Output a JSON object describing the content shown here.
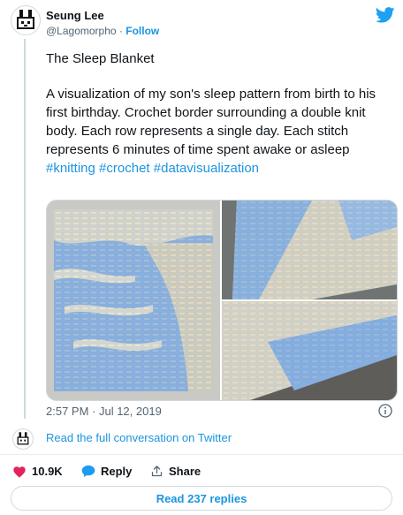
{
  "author": {
    "name": "Seung Lee",
    "handle": "@Lagomorpho",
    "separator": "·",
    "follow_label": "Follow"
  },
  "tweet": {
    "title": "The Sleep Blanket",
    "body": "A visualization of my son's sleep pattern from birth to his first birthday. Crochet border surrounding a double knit body. Each row represents a single day. Each stitch represents 6 minutes of time spent awake or asleep",
    "hashtags": [
      "#knitting",
      "#crochet",
      "#datavisualization"
    ],
    "timestamp": "2:57 PM · Jul 12, 2019"
  },
  "conversation_link": "Read the full conversation on Twitter",
  "actions": {
    "likes": "10.9K",
    "reply_label": "Reply",
    "share_label": "Share"
  },
  "read_replies": "Read 237 replies",
  "colors": {
    "link_blue": "#1b95e0",
    "heart_red": "#e0245e",
    "twitter_blue": "#1da1f2",
    "muted_text": "#536471"
  },
  "icons": [
    "pixel-bunny-avatar",
    "twitter-bird-icon",
    "info-icon",
    "heart-icon",
    "reply-bubble-icon",
    "share-icon"
  ]
}
